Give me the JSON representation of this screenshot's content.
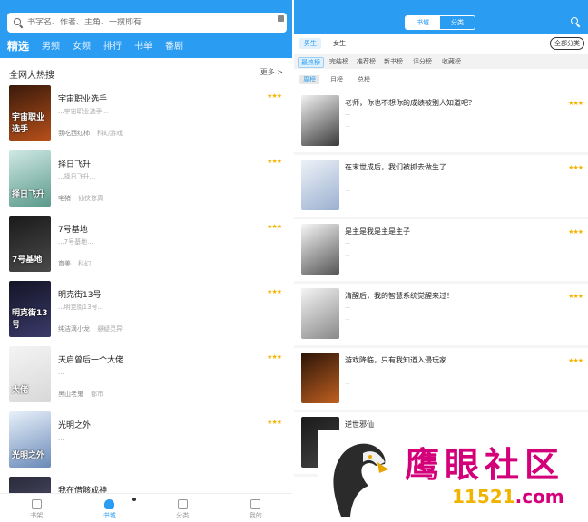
{
  "left": {
    "search": {
      "placeholder": "书字名、作者、主角、一搜即有"
    },
    "tabs": [
      "精选",
      "男频",
      "女频",
      "排行",
      "书单",
      "番剧"
    ],
    "section": {
      "title": "全网大热搜",
      "more": "更多 >"
    },
    "books": [
      {
        "title": "宇宙职业选手",
        "stars": "★★★",
        "desc": "...宇宙职业选手...",
        "author": "我吃西红柿",
        "category": "科幻游戏",
        "cover_text": "宇宙职业选手",
        "cover_colors": [
          "#3a1a0a",
          "#b8501a"
        ]
      },
      {
        "title": "择日飞升",
        "stars": "★★★",
        "desc": "...择日飞升...",
        "author": "宅猪",
        "category": "仙侠修真",
        "cover_text": "择日飞升",
        "cover_colors": [
          "#cfe8e4",
          "#5a9a8a"
        ]
      },
      {
        "title": "7号基地",
        "stars": "★★★",
        "desc": "...7号基地...",
        "author": "育美",
        "category": "科幻",
        "cover_text": "7号基地",
        "cover_colors": [
          "#1a1a1a",
          "#4a4a4a"
        ]
      },
      {
        "title": "明克街13号",
        "stars": "★★★",
        "desc": "...明克街13号...",
        "author": "纯洁滴小龙",
        "category": "悬疑灵异",
        "cover_text": "明克街13号",
        "cover_colors": [
          "#141426",
          "#3a3a6a"
        ]
      },
      {
        "title": "天启曾后一个大佬",
        "stars": "★★★",
        "desc": "...",
        "author": "黑山老鬼",
        "category": "都市",
        "cover_text": "大佬",
        "cover_colors": [
          "#f4f4f4",
          "#d8d8d8"
        ]
      },
      {
        "title": "光明之外",
        "stars": "★★★",
        "desc": "...",
        "author": "",
        "category": "",
        "cover_text": "光明之外",
        "cover_colors": [
          "#e8f0fa",
          "#6a8ab8"
        ]
      },
      {
        "title": "我在借骸成神",
        "stars": "",
        "desc": "",
        "author": "",
        "category": "",
        "cover_text": "",
        "cover_colors": [
          "#2a2a3a",
          "#5a5a7a"
        ]
      }
    ],
    "bottom_nav": [
      "书架",
      "书城",
      "分类",
      "我的"
    ]
  },
  "right": {
    "segments": [
      "书城",
      "分类"
    ],
    "gender": [
      "男生",
      "女生"
    ],
    "all_categories": "全部分类",
    "rank_tabs": [
      "最热榜",
      "完结榜",
      "推荐榜",
      "新书榜",
      "评分榜",
      "收藏榜"
    ],
    "period_tabs": [
      "周榜",
      "月榜",
      "总榜"
    ],
    "books": [
      {
        "title": "老师，你也不想你的成绩被别人知道吧？",
        "stars": "★★★",
        "meta": "...",
        "desc": "...",
        "cover_colors": [
          "#f2f2f2",
          "#3a3a3a"
        ]
      },
      {
        "title": "在末世成后，我们被抓去做生了",
        "stars": "★★★",
        "meta": "...",
        "desc": "...",
        "cover_colors": [
          "#eef2f8",
          "#9ab0d0"
        ]
      },
      {
        "title": "是主是我是主是主子",
        "stars": "★★★",
        "meta": "...",
        "desc": "...",
        "cover_colors": [
          "#f6f6f6",
          "#555555"
        ]
      },
      {
        "title": "清醒后，我的智慧系统觉醒来过！",
        "stars": "★★★",
        "meta": "...",
        "desc": "...",
        "cover_colors": [
          "#f4f4f4",
          "#888888"
        ]
      },
      {
        "title": "游戏降临，只有我知道入侵玩家",
        "stars": "★★★",
        "meta": "...",
        "desc": "...",
        "cover_colors": [
          "#2a1408",
          "#c06020"
        ]
      },
      {
        "title": "逆世邪仙",
        "stars": "",
        "meta": "",
        "desc": "",
        "cover_colors": [
          "#1a1a1a",
          "#444444"
        ]
      }
    ]
  },
  "watermark": {
    "text": "鹰眼社区",
    "url_num": "11521",
    "url_tld": ".com"
  },
  "colors": {
    "primary": "#2a9cf2",
    "star": "#f5b400",
    "watermark": "#d4007a"
  }
}
